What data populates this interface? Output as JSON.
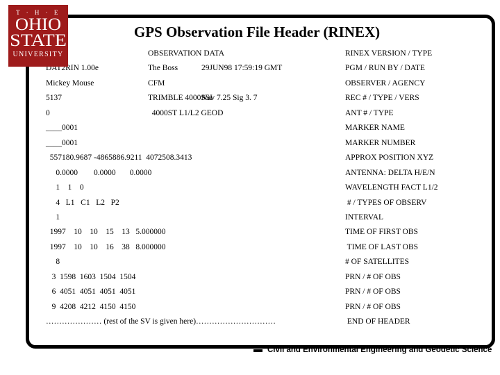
{
  "logo": {
    "the": "T · H · E",
    "ohio": "OHIO",
    "state": "STATE",
    "university": "UNIVERSITY",
    "color": "#9e1b1b"
  },
  "title": "GPS Observation File Header (RINEX)",
  "header_rows": [
    {
      "left": "",
      "mid": "OBSERVATION DATA",
      "mid2": "",
      "right": "RINEX VERSION / TYPE"
    },
    {
      "left": "DAT2RIN 1.00e",
      "mid": "The Boss",
      "mid2": "29JUN98 17:59:19 GMT",
      "right": "PGM / RUN BY / DATE"
    },
    {
      "left": "Mickey Mouse",
      "mid": "CFM",
      "mid2": "",
      "right": "OBSERVER / AGENCY"
    },
    {
      "left": "5137",
      "mid": "TRIMBLE 4000SSI",
      "mid2": "Nav 7.25 Sig 3. 7",
      "right": "REC # / TYPE / VERS"
    },
    {
      "left": "0",
      "mid": "  4000ST L1/L2 GEOD",
      "mid2": "",
      "right": "ANT # / TYPE"
    },
    {
      "left": "____0001",
      "mid": "",
      "mid2": "",
      "right": "MARKER NAME"
    },
    {
      "left": "____0001",
      "mid": "",
      "mid2": "",
      "right": "MARKER NUMBER"
    },
    {
      "left": "  557180.9687 -4865886.9211  4072508.3413",
      "mid": "",
      "mid2": "",
      "right": "APPROX POSITION XYZ"
    },
    {
      "left": "     0.0000        0.0000       0.0000",
      "mid": "",
      "mid2": "",
      "right": "ANTENNA: DELTA H/E/N"
    },
    {
      "left": "     1    1    0",
      "mid": "",
      "mid2": "",
      "right": "WAVELENGTH FACT L1/2"
    },
    {
      "left": "     4   L1   C1   L2   P2",
      "mid": "",
      "mid2": "",
      "right": " # / TYPES OF OBSERV"
    },
    {
      "left": "     1",
      "mid": "",
      "mid2": "",
      "right": "INTERVAL"
    },
    {
      "left": "  1997    10    10    15    13   5.000000",
      "mid": "",
      "mid2": "",
      "right": "TIME OF FIRST OBS"
    },
    {
      "left": "  1997    10    10    16    38   8.000000",
      "mid": "",
      "mid2": "",
      "right": " TIME OF LAST OBS"
    },
    {
      "left": "     8",
      "mid": "",
      "mid2": "",
      "right": "# OF SATELLITES"
    },
    {
      "left": "   3  1598  1603  1504  1504",
      "mid": "",
      "mid2": "",
      "right": "PRN / # OF OBS"
    },
    {
      "left": "   6  4051  4051  4051  4051",
      "mid": "",
      "mid2": "",
      "right": "PRN / # OF OBS"
    },
    {
      "left": "   9  4208  4212  4150  4150",
      "mid": "",
      "mid2": "",
      "right": "PRN / # OF OBS"
    },
    {
      "left": "………………… (rest of the SV is given here)…………………………",
      "mid": "",
      "mid2": "",
      "right": " END OF HEADER"
    }
  ],
  "footer": {
    "text": "Civil and Environmental Engineering and Geodetic Science"
  }
}
